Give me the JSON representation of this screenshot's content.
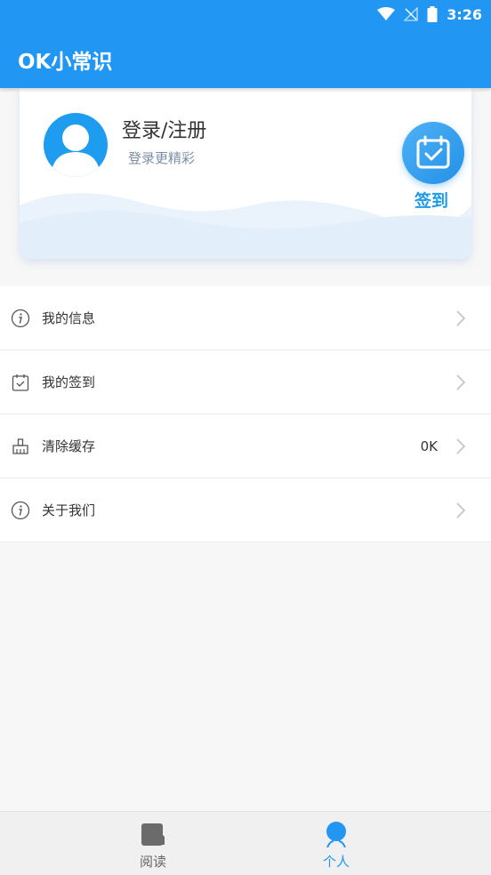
{
  "status_bar": {
    "time": "3:26"
  },
  "app": {
    "title": "OK小常识"
  },
  "profile": {
    "login_title": "登录/注册",
    "login_subtitle": "登录更精彩",
    "checkin_label": "签到"
  },
  "menu": {
    "items": [
      {
        "label": "我的信息",
        "icon": "info-icon",
        "value": ""
      },
      {
        "label": "我的签到",
        "icon": "checkin-calendar-icon",
        "value": ""
      },
      {
        "label": "清除缓存",
        "icon": "broom-icon",
        "value": "0K"
      },
      {
        "label": "关于我们",
        "icon": "info-icon",
        "value": ""
      }
    ]
  },
  "bottom_nav": {
    "items": [
      {
        "label": "阅读",
        "icon": "book-icon",
        "active": false
      },
      {
        "label": "个人",
        "icon": "person-icon",
        "active": true
      }
    ]
  },
  "colors": {
    "primary": "#2196f3",
    "active_nav": "#2196f3",
    "inactive_nav": "#666666"
  }
}
